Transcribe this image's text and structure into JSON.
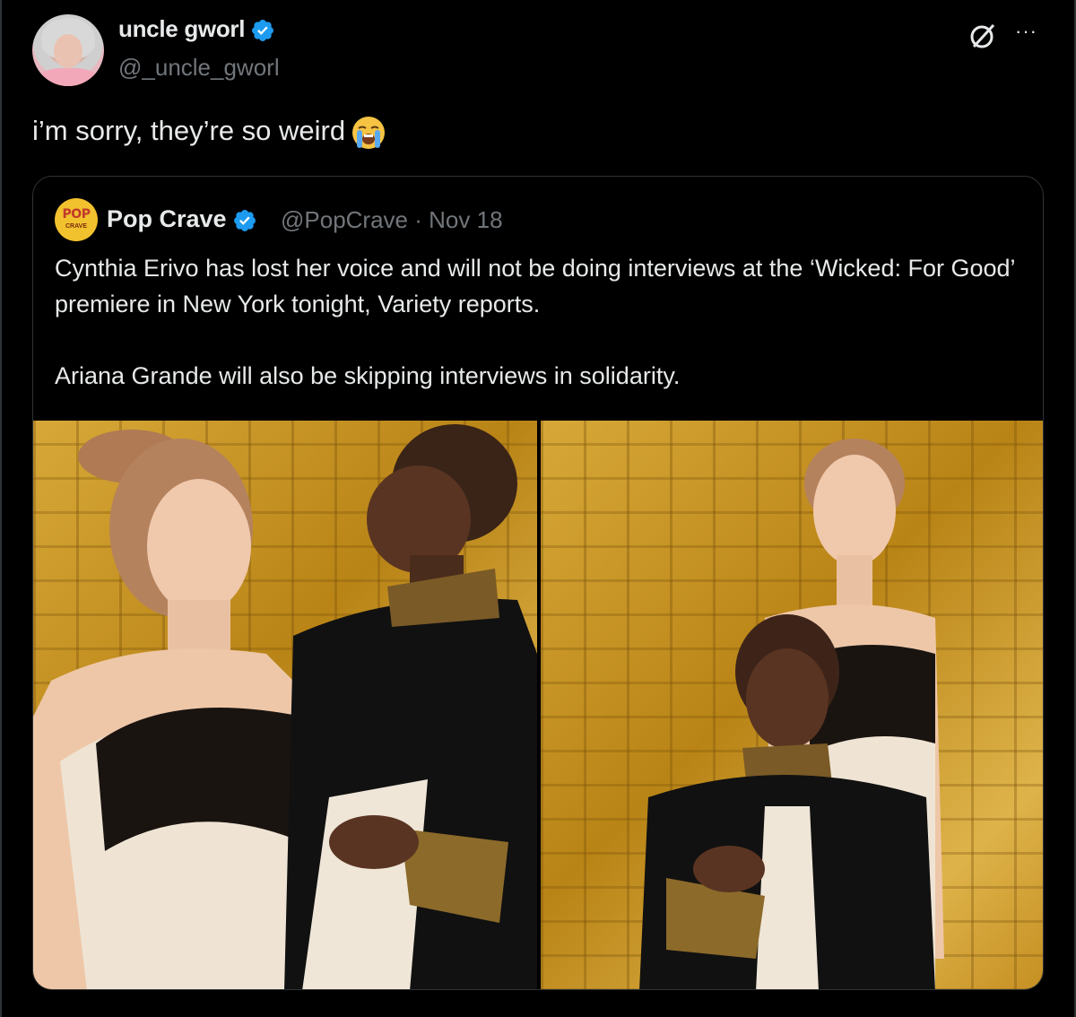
{
  "post": {
    "display_name": "uncle gworl",
    "handle": "@_uncle_gworl",
    "text": "i’m sorry, they’re so weird",
    "emoji": "loudly-crying-face",
    "more_label": "···"
  },
  "quoted": {
    "display_name": "Pop Crave",
    "handle": "@PopCrave",
    "separator": "·",
    "date": "Nov 18",
    "avatar_text_top": "POP",
    "avatar_text_bottom": "CRAVE",
    "paragraphs": [
      "Cynthia Erivo has lost her voice and will not be doing interviews at the ‘Wicked: For Good’ premiere in New York tonight, Variety reports.",
      "Ariana Grande will also be skipping interviews in solidarity."
    ]
  },
  "colors": {
    "background": "#000000",
    "text": "#e7e9ea",
    "secondary": "#71767b",
    "verified": "#1d9bf0",
    "border": "#2f3336"
  }
}
